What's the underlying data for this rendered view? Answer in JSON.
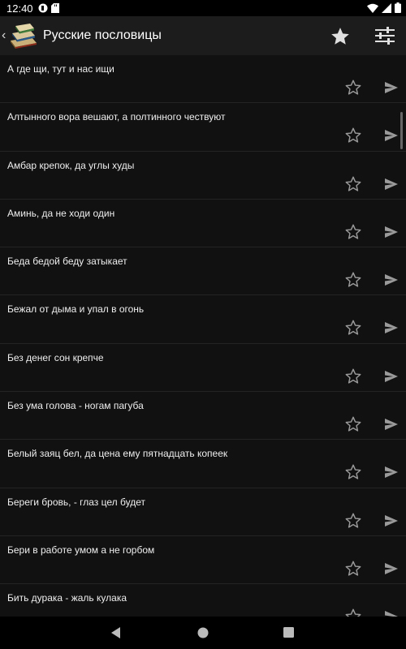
{
  "status_bar": {
    "time": "12:40",
    "icons_left": [
      "app-notification-icon",
      "sd-card-icon"
    ],
    "icons_right": [
      "wifi-icon",
      "cellular-icon",
      "battery-icon"
    ]
  },
  "app_bar": {
    "title": "Русские пословицы",
    "back_icon": "chevron-left-icon",
    "logo": "books-logo",
    "actions": [
      {
        "name": "favorites-star-icon"
      },
      {
        "name": "filter-sliders-icon"
      }
    ]
  },
  "proverbs": [
    {
      "text": "А где щи, тут и нас ищи"
    },
    {
      "text": "Алтынного вора вешают, а полтинного чествуют"
    },
    {
      "text": "Амбар крепок, да углы худы"
    },
    {
      "text": "Аминь, да не ходи один"
    },
    {
      "text": "Беда бедой беду затыкает"
    },
    {
      "text": "Бежал от дыма и упал в огонь"
    },
    {
      "text": "Без денег сон крепче"
    },
    {
      "text": "Без ума голова - ногам пагуба"
    },
    {
      "text": "Белый заяц бел, да цена ему пятнадцать копеек"
    },
    {
      "text": "Береги бровь, - глаз цел будет"
    },
    {
      "text": "Бери в работе умом а не горбом"
    },
    {
      "text": "Бить дурака - жаль кулака"
    }
  ],
  "nav_bar": {
    "buttons": [
      "nav-back-icon",
      "nav-home-icon",
      "nav-recents-icon"
    ]
  },
  "colors": {
    "background": "#111111",
    "app_bar": "#1c1c1c",
    "text": "#eeeeee",
    "icon": "#9a9a9a"
  }
}
